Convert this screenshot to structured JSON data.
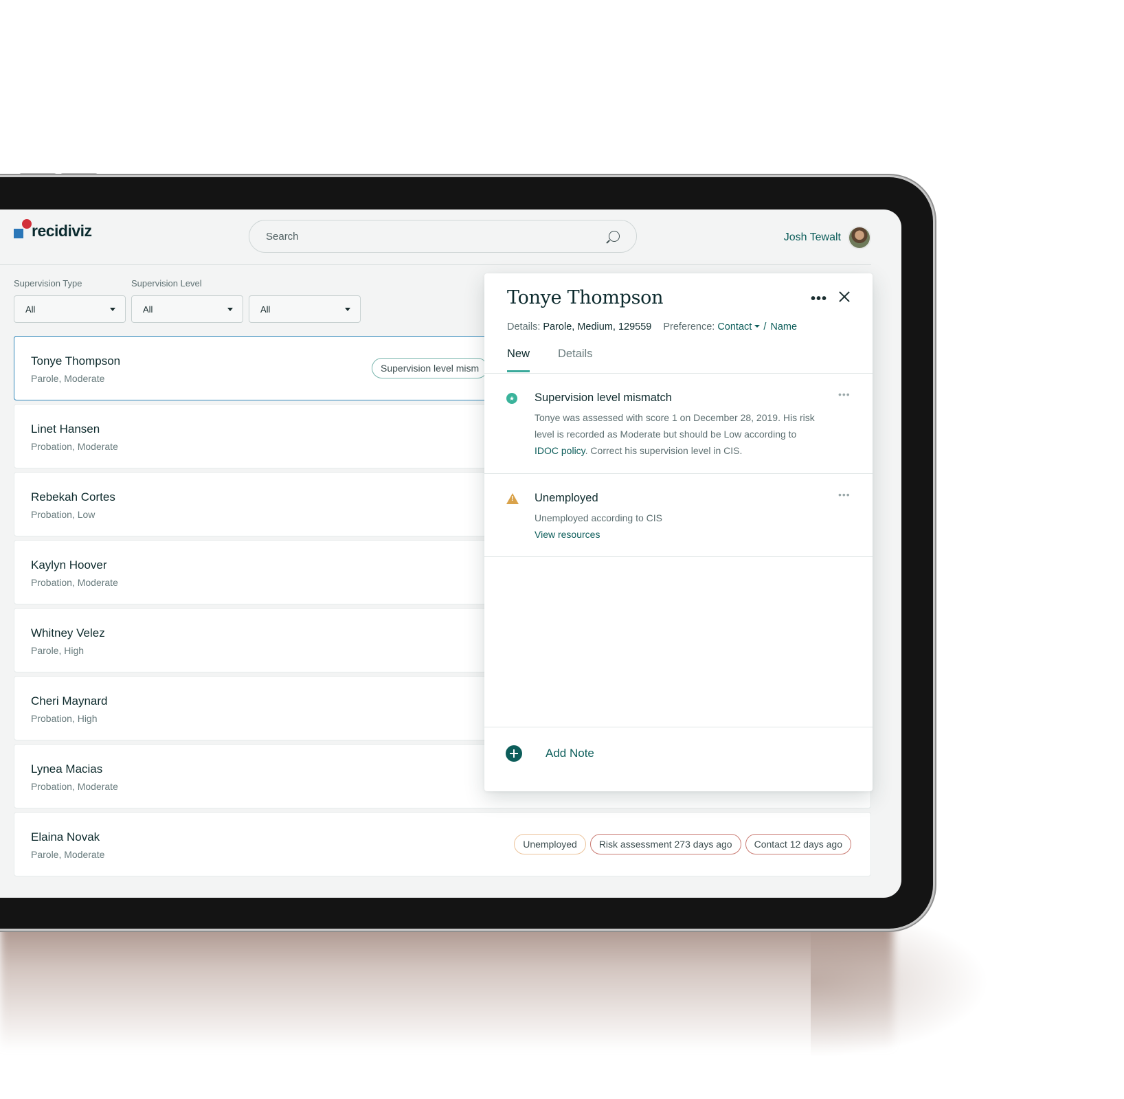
{
  "header": {
    "logo_text": "recidiviz",
    "search_placeholder": "Search",
    "user_name": "Josh Tewalt"
  },
  "filters": [
    {
      "label": "Supervision Type",
      "value": "All"
    },
    {
      "label": "Supervision Level",
      "value": "All"
    },
    {
      "label": "",
      "value": "All"
    }
  ],
  "clients": [
    {
      "name": "Tonye Thompson",
      "sub": "Parole, Moderate",
      "chips": [
        {
          "text": "Supervision level mism",
          "tone": "teal"
        }
      ]
    },
    {
      "name": "Linet Hansen",
      "sub": "Probation, Moderate",
      "chips": []
    },
    {
      "name": "Rebekah Cortes",
      "sub": "Probation, Low",
      "chips": []
    },
    {
      "name": "Kaylyn Hoover",
      "sub": "Probation, Moderate",
      "chips": []
    },
    {
      "name": "Whitney Velez",
      "sub": "Parole, High",
      "chips": []
    },
    {
      "name": "Cheri Maynard",
      "sub": "Probation, High",
      "chips": []
    },
    {
      "name": "Lynea Macias",
      "sub": "Probation, Moderate",
      "chips": []
    },
    {
      "name": "Elaina Novak",
      "sub": "Parole, Moderate",
      "chips": [
        {
          "text": "Unemployed",
          "tone": "amber"
        },
        {
          "text": "Risk assessment 273 days ago",
          "tone": "red"
        },
        {
          "text": "Contact 12 days ago",
          "tone": "red"
        }
      ]
    }
  ],
  "panel": {
    "title": "Tonye Thompson",
    "details_label": "Details:",
    "details_value": "Parole, Medium, 129559",
    "preference_label": "Preference:",
    "preference_contact": "Contact",
    "preference_sep": "/",
    "preference_name": "Name",
    "tabs": [
      {
        "label": "New"
      },
      {
        "label": "Details"
      }
    ],
    "items": [
      {
        "title": "Supervision level mismatch",
        "body_1": "Tonye was assessed with score 1 on December 28, 2019. His risk level is recorded as Moderate but should be Low according to ",
        "body_link": "IDOC policy",
        "body_2": ". Correct his supervision level in CIS."
      },
      {
        "title": "Unemployed",
        "body_1": "Unemployed according to CIS",
        "body_link": "View resources"
      }
    ],
    "add_note_label": "Add Note"
  },
  "colors": {
    "brand_teal": "#0c5d5a",
    "accent_green": "#3aa99b",
    "selected_border": "#2f86b8",
    "warning": "#d9a24a"
  }
}
